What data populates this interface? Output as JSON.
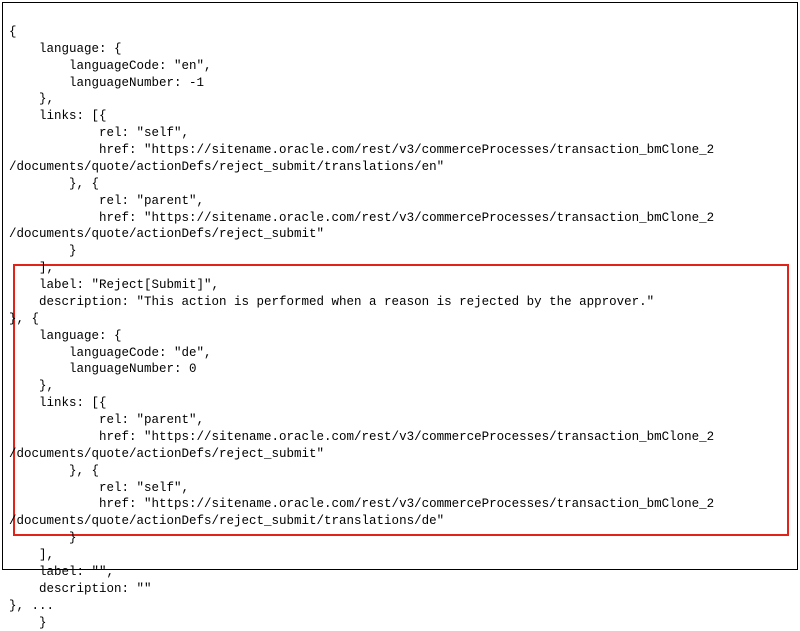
{
  "line1": "{",
  "line2": "    language: {",
  "line3": "        languageCode: \"en\",",
  "line4": "        languageNumber: -1",
  "line5": "    },",
  "line6": "    links: [{",
  "line7": "            rel: \"self\",",
  "line8": "            href: \"https://sitename.oracle.com/rest/v3/commerceProcesses/transaction_bmClone_2",
  "line9": "/documents/quote/actionDefs/reject_submit/translations/en\"",
  "line10": "        }, {",
  "line11": "            rel: \"parent\",",
  "line12": "            href: \"https://sitename.oracle.com/rest/v3/commerceProcesses/transaction_bmClone_2",
  "line13": "/documents/quote/actionDefs/reject_submit\"",
  "line14": "        }",
  "line15": "    ],",
  "line16": "    label: \"Reject[Submit]\",",
  "line17": "    description: \"This action is performed when a reason is rejected by the approver.\"",
  "line18": "}, {",
  "line19": "    language: {",
  "line20": "        languageCode: \"de\",",
  "line21": "        languageNumber: 0",
  "line22": "    },",
  "line23": "    links: [{",
  "line24": "            rel: \"parent\",",
  "line25": "            href: \"https://sitename.oracle.com/rest/v3/commerceProcesses/transaction_bmClone_2",
  "line26": "/documents/quote/actionDefs/reject_submit\"",
  "line27": "        }, {",
  "line28": "            rel: \"self\",",
  "line29": "            href: \"https://sitename.oracle.com/rest/v3/commerceProcesses/transaction_bmClone_2",
  "line30": "/documents/quote/actionDefs/reject_submit/translations/de\"",
  "line31": "        }",
  "line32": "    ],",
  "line33": "    label: \"\",",
  "line34": "    description: \"\"",
  "line35": "}, ...",
  "line36": "    }"
}
